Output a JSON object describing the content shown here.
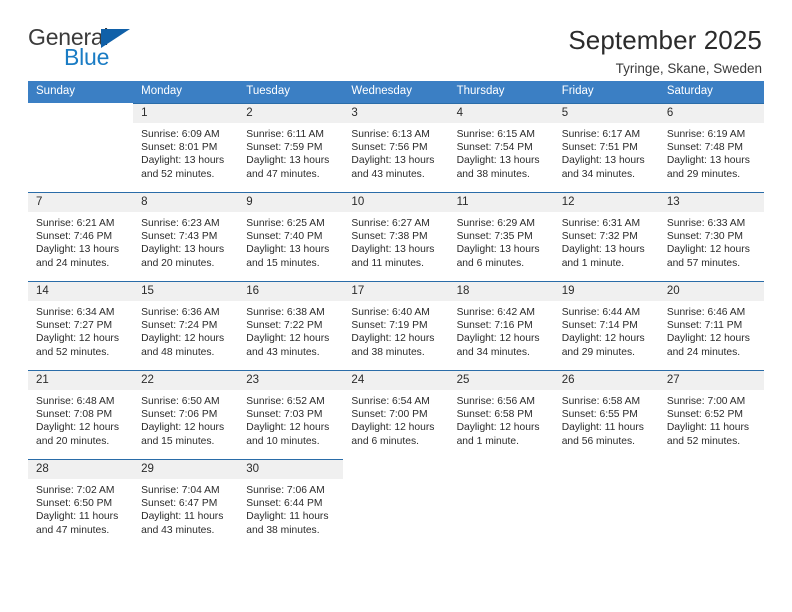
{
  "brand": {
    "word_one": "General",
    "word_two": "Blue",
    "flag_icon": "triangle-flag-icon",
    "colors": {
      "general": "#3b3b3b",
      "blue": "#1a7cc4",
      "flag": "#1060a8"
    }
  },
  "header": {
    "title": "September 2025",
    "location": "Tyringe, Skane, Sweden"
  },
  "theme": {
    "header_row_bg": "#3b7fc4",
    "header_row_text": "#ffffff",
    "daynum_bg": "#f0f0f0",
    "cell_top_border": "#2a6ca8",
    "body_text": "#2b2b2b"
  },
  "calendar": {
    "weekday_headers": [
      "Sunday",
      "Monday",
      "Tuesday",
      "Wednesday",
      "Thursday",
      "Friday",
      "Saturday"
    ],
    "weeks": [
      [
        {
          "day": "",
          "lines": []
        },
        {
          "day": "1",
          "lines": [
            "Sunrise: 6:09 AM",
            "Sunset: 8:01 PM",
            "Daylight: 13 hours",
            "and 52 minutes."
          ]
        },
        {
          "day": "2",
          "lines": [
            "Sunrise: 6:11 AM",
            "Sunset: 7:59 PM",
            "Daylight: 13 hours",
            "and 47 minutes."
          ]
        },
        {
          "day": "3",
          "lines": [
            "Sunrise: 6:13 AM",
            "Sunset: 7:56 PM",
            "Daylight: 13 hours",
            "and 43 minutes."
          ]
        },
        {
          "day": "4",
          "lines": [
            "Sunrise: 6:15 AM",
            "Sunset: 7:54 PM",
            "Daylight: 13 hours",
            "and 38 minutes."
          ]
        },
        {
          "day": "5",
          "lines": [
            "Sunrise: 6:17 AM",
            "Sunset: 7:51 PM",
            "Daylight: 13 hours",
            "and 34 minutes."
          ]
        },
        {
          "day": "6",
          "lines": [
            "Sunrise: 6:19 AM",
            "Sunset: 7:48 PM",
            "Daylight: 13 hours",
            "and 29 minutes."
          ]
        }
      ],
      [
        {
          "day": "7",
          "lines": [
            "Sunrise: 6:21 AM",
            "Sunset: 7:46 PM",
            "Daylight: 13 hours",
            "and 24 minutes."
          ]
        },
        {
          "day": "8",
          "lines": [
            "Sunrise: 6:23 AM",
            "Sunset: 7:43 PM",
            "Daylight: 13 hours",
            "and 20 minutes."
          ]
        },
        {
          "day": "9",
          "lines": [
            "Sunrise: 6:25 AM",
            "Sunset: 7:40 PM",
            "Daylight: 13 hours",
            "and 15 minutes."
          ]
        },
        {
          "day": "10",
          "lines": [
            "Sunrise: 6:27 AM",
            "Sunset: 7:38 PM",
            "Daylight: 13 hours",
            "and 11 minutes."
          ]
        },
        {
          "day": "11",
          "lines": [
            "Sunrise: 6:29 AM",
            "Sunset: 7:35 PM",
            "Daylight: 13 hours",
            "and 6 minutes."
          ]
        },
        {
          "day": "12",
          "lines": [
            "Sunrise: 6:31 AM",
            "Sunset: 7:32 PM",
            "Daylight: 13 hours",
            "and 1 minute."
          ]
        },
        {
          "day": "13",
          "lines": [
            "Sunrise: 6:33 AM",
            "Sunset: 7:30 PM",
            "Daylight: 12 hours",
            "and 57 minutes."
          ]
        }
      ],
      [
        {
          "day": "14",
          "lines": [
            "Sunrise: 6:34 AM",
            "Sunset: 7:27 PM",
            "Daylight: 12 hours",
            "and 52 minutes."
          ]
        },
        {
          "day": "15",
          "lines": [
            "Sunrise: 6:36 AM",
            "Sunset: 7:24 PM",
            "Daylight: 12 hours",
            "and 48 minutes."
          ]
        },
        {
          "day": "16",
          "lines": [
            "Sunrise: 6:38 AM",
            "Sunset: 7:22 PM",
            "Daylight: 12 hours",
            "and 43 minutes."
          ]
        },
        {
          "day": "17",
          "lines": [
            "Sunrise: 6:40 AM",
            "Sunset: 7:19 PM",
            "Daylight: 12 hours",
            "and 38 minutes."
          ]
        },
        {
          "day": "18",
          "lines": [
            "Sunrise: 6:42 AM",
            "Sunset: 7:16 PM",
            "Daylight: 12 hours",
            "and 34 minutes."
          ]
        },
        {
          "day": "19",
          "lines": [
            "Sunrise: 6:44 AM",
            "Sunset: 7:14 PM",
            "Daylight: 12 hours",
            "and 29 minutes."
          ]
        },
        {
          "day": "20",
          "lines": [
            "Sunrise: 6:46 AM",
            "Sunset: 7:11 PM",
            "Daylight: 12 hours",
            "and 24 minutes."
          ]
        }
      ],
      [
        {
          "day": "21",
          "lines": [
            "Sunrise: 6:48 AM",
            "Sunset: 7:08 PM",
            "Daylight: 12 hours",
            "and 20 minutes."
          ]
        },
        {
          "day": "22",
          "lines": [
            "Sunrise: 6:50 AM",
            "Sunset: 7:06 PM",
            "Daylight: 12 hours",
            "and 15 minutes."
          ]
        },
        {
          "day": "23",
          "lines": [
            "Sunrise: 6:52 AM",
            "Sunset: 7:03 PM",
            "Daylight: 12 hours",
            "and 10 minutes."
          ]
        },
        {
          "day": "24",
          "lines": [
            "Sunrise: 6:54 AM",
            "Sunset: 7:00 PM",
            "Daylight: 12 hours",
            "and 6 minutes."
          ]
        },
        {
          "day": "25",
          "lines": [
            "Sunrise: 6:56 AM",
            "Sunset: 6:58 PM",
            "Daylight: 12 hours",
            "and 1 minute."
          ]
        },
        {
          "day": "26",
          "lines": [
            "Sunrise: 6:58 AM",
            "Sunset: 6:55 PM",
            "Daylight: 11 hours",
            "and 56 minutes."
          ]
        },
        {
          "day": "27",
          "lines": [
            "Sunrise: 7:00 AM",
            "Sunset: 6:52 PM",
            "Daylight: 11 hours",
            "and 52 minutes."
          ]
        }
      ],
      [
        {
          "day": "28",
          "lines": [
            "Sunrise: 7:02 AM",
            "Sunset: 6:50 PM",
            "Daylight: 11 hours",
            "and 47 minutes."
          ]
        },
        {
          "day": "29",
          "lines": [
            "Sunrise: 7:04 AM",
            "Sunset: 6:47 PM",
            "Daylight: 11 hours",
            "and 43 minutes."
          ]
        },
        {
          "day": "30",
          "lines": [
            "Sunrise: 7:06 AM",
            "Sunset: 6:44 PM",
            "Daylight: 11 hours",
            "and 38 minutes."
          ]
        },
        {
          "day": "",
          "lines": []
        },
        {
          "day": "",
          "lines": []
        },
        {
          "day": "",
          "lines": []
        },
        {
          "day": "",
          "lines": []
        }
      ]
    ]
  }
}
